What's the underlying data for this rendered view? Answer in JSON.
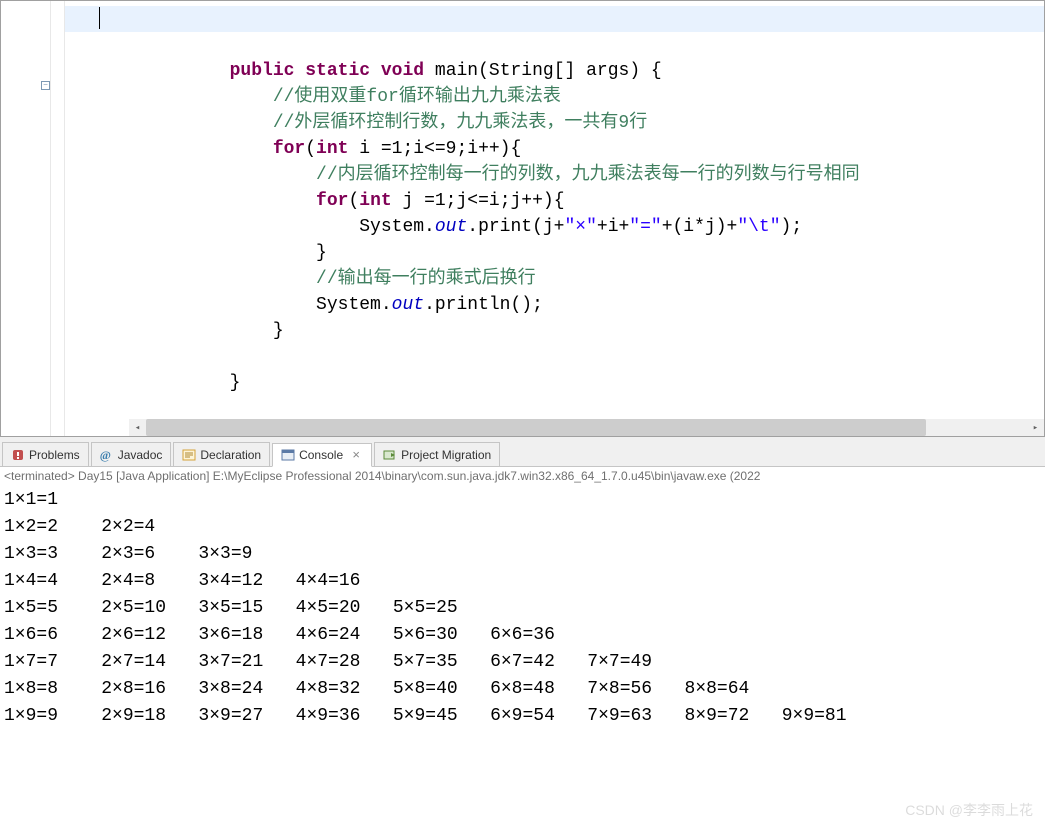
{
  "editor": {
    "lines": [
      {
        "type": "blank",
        "indent": 0,
        "text": ""
      },
      {
        "type": "blank",
        "indent": 0,
        "text": ""
      },
      {
        "type": "method_sig",
        "indent": 3,
        "keywords": [
          "public",
          "static",
          "void"
        ],
        "name": "main",
        "params": "(String[] args) {"
      },
      {
        "type": "comment",
        "indent": 4,
        "text": "//使用双重for循环输出九九乘法表"
      },
      {
        "type": "comment",
        "indent": 4,
        "text": "//外层循环控制行数，九九乘法表，一共有9行"
      },
      {
        "type": "for_outer",
        "indent": 4,
        "kw": "for",
        "kw2": "int",
        "body": " i =1;i<=9;i++){"
      },
      {
        "type": "comment",
        "indent": 5,
        "text": "//内层循环控制每一行的列数，九九乘法表每一行的列数与行号相同"
      },
      {
        "type": "for_inner",
        "indent": 5,
        "kw": "for",
        "kw2": "int",
        "body": " j =1;j<=i;j++){"
      },
      {
        "type": "print",
        "indent": 6,
        "prefix": "System.",
        "staticRef": "out",
        "method": ".print(j+",
        "s1": "\"×\"",
        "m2": "+i+",
        "s2": "\"=\"",
        "m3": "+(i*j)+",
        "s3": "\"\\t\"",
        "suffix": ");"
      },
      {
        "type": "brace",
        "indent": 5,
        "text": "}"
      },
      {
        "type": "comment",
        "indent": 5,
        "text": "//输出每一行的乘式后换行"
      },
      {
        "type": "println",
        "indent": 5,
        "prefix": "System.",
        "staticRef": "out",
        "method": ".println();"
      },
      {
        "type": "brace",
        "indent": 4,
        "text": "}"
      },
      {
        "type": "blank",
        "indent": 0,
        "text": ""
      },
      {
        "type": "brace_partial",
        "indent": 3,
        "text": "}"
      }
    ]
  },
  "tabs": [
    {
      "label": "Problems",
      "icon": "problems",
      "active": false
    },
    {
      "label": "Javadoc",
      "icon": "javadoc",
      "active": false
    },
    {
      "label": "Declaration",
      "icon": "declaration",
      "active": false
    },
    {
      "label": "Console",
      "icon": "console",
      "active": true
    },
    {
      "label": "Project Migration",
      "icon": "migration",
      "active": false
    }
  ],
  "console": {
    "header": "<terminated> Day15 [Java Application] E:\\MyEclipse Professional 2014\\binary\\com.sun.java.jdk7.win32.x86_64_1.7.0.u45\\bin\\javaw.exe (2022",
    "output_rows": [
      [
        "1×1=1"
      ],
      [
        "1×2=2",
        "2×2=4"
      ],
      [
        "1×3=3",
        "2×3=6",
        "3×3=9"
      ],
      [
        "1×4=4",
        "2×4=8",
        "3×4=12",
        "4×4=16"
      ],
      [
        "1×5=5",
        "2×5=10",
        "3×5=15",
        "4×5=20",
        "5×5=25"
      ],
      [
        "1×6=6",
        "2×6=12",
        "3×6=18",
        "4×6=24",
        "5×6=30",
        "6×6=36"
      ],
      [
        "1×7=7",
        "2×7=14",
        "3×7=21",
        "4×7=28",
        "5×7=35",
        "6×7=42",
        "7×7=49"
      ],
      [
        "1×8=8",
        "2×8=16",
        "3×8=24",
        "4×8=32",
        "5×8=40",
        "6×8=48",
        "7×8=56",
        "8×8=64"
      ],
      [
        "1×9=9",
        "2×9=18",
        "3×9=27",
        "4×9=36",
        "5×9=45",
        "6×9=54",
        "7×9=63",
        "8×9=72",
        "9×9=81"
      ]
    ]
  },
  "watermark": "CSDN @李李雨上花"
}
